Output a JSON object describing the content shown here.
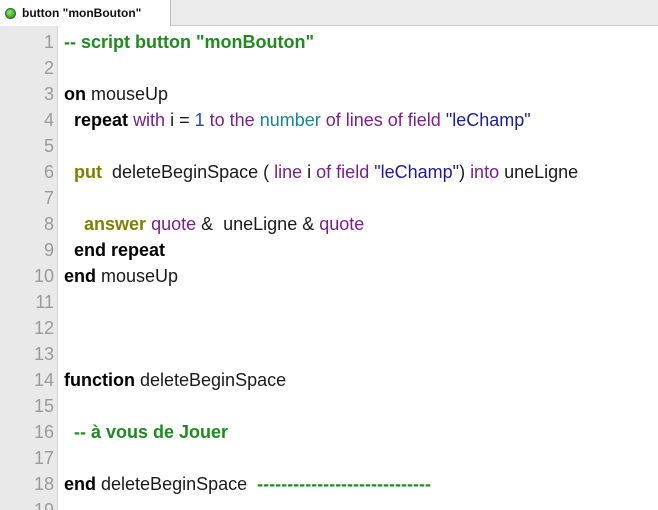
{
  "tab": {
    "title": "button \"monBouton\"",
    "status_color": "#46b32e"
  },
  "colors": {
    "keyword": "#000000",
    "command": "#808000",
    "purple": "#7b1f8a",
    "teal": "#138a8a",
    "number": "#1f3fcf",
    "string": "#1c1c9c",
    "comment": "#1e8b1e",
    "line_number": "#9a9a9a"
  },
  "code": {
    "lines": [
      {
        "number": "1",
        "tokens": [
          {
            "t": "-- script button \"monBouton\"",
            "k": "comment"
          }
        ]
      },
      {
        "number": "2",
        "tokens": []
      },
      {
        "number": "3",
        "tokens": [
          {
            "t": "on",
            "k": "kw"
          },
          {
            "t": " mouseUp",
            "k": "plain"
          }
        ]
      },
      {
        "number": "4",
        "tokens": [
          {
            "t": "  ",
            "k": "plain"
          },
          {
            "t": "repeat",
            "k": "kw"
          },
          {
            "t": " ",
            "k": "plain"
          },
          {
            "t": "with",
            "k": "purple"
          },
          {
            "t": " i = ",
            "k": "plain"
          },
          {
            "t": "1",
            "k": "num"
          },
          {
            "t": " ",
            "k": "plain"
          },
          {
            "t": "to the",
            "k": "purple"
          },
          {
            "t": " ",
            "k": "plain"
          },
          {
            "t": "number",
            "k": "teal"
          },
          {
            "t": " ",
            "k": "plain"
          },
          {
            "t": "of lines of field",
            "k": "purple"
          },
          {
            "t": " ",
            "k": "plain"
          },
          {
            "t": "\"leChamp\"",
            "k": "str"
          }
        ]
      },
      {
        "number": "5",
        "tokens": []
      },
      {
        "number": "6",
        "tokens": [
          {
            "t": "  ",
            "k": "plain"
          },
          {
            "t": "put",
            "k": "cmd"
          },
          {
            "t": "  deleteBeginSpace ( ",
            "k": "plain"
          },
          {
            "t": "line",
            "k": "purple"
          },
          {
            "t": " i ",
            "k": "plain"
          },
          {
            "t": "of field",
            "k": "purple"
          },
          {
            "t": " ",
            "k": "plain"
          },
          {
            "t": "\"leChamp\"",
            "k": "str"
          },
          {
            "t": ") ",
            "k": "plain"
          },
          {
            "t": "into",
            "k": "purple"
          },
          {
            "t": " uneLigne",
            "k": "plain"
          }
        ]
      },
      {
        "number": "7",
        "tokens": []
      },
      {
        "number": "8",
        "tokens": [
          {
            "t": "    ",
            "k": "plain"
          },
          {
            "t": "answer",
            "k": "cmd"
          },
          {
            "t": " ",
            "k": "plain"
          },
          {
            "t": "quote",
            "k": "purple"
          },
          {
            "t": " &  uneLigne & ",
            "k": "plain"
          },
          {
            "t": "quote",
            "k": "purple"
          }
        ]
      },
      {
        "number": "9",
        "tokens": [
          {
            "t": "  ",
            "k": "plain"
          },
          {
            "t": "end repeat",
            "k": "kw"
          }
        ]
      },
      {
        "number": "10",
        "tokens": [
          {
            "t": "end",
            "k": "kw"
          },
          {
            "t": " mouseUp",
            "k": "plain"
          }
        ]
      },
      {
        "number": "11",
        "tokens": []
      },
      {
        "number": "12",
        "tokens": []
      },
      {
        "number": "13",
        "tokens": []
      },
      {
        "number": "14",
        "tokens": [
          {
            "t": "function",
            "k": "kw"
          },
          {
            "t": " deleteBeginSpace",
            "k": "plain"
          }
        ]
      },
      {
        "number": "15",
        "tokens": []
      },
      {
        "number": "16",
        "tokens": [
          {
            "t": "  ",
            "k": "plain"
          },
          {
            "t": "-- à vous de Jouer",
            "k": "comment"
          }
        ]
      },
      {
        "number": "17",
        "tokens": []
      },
      {
        "number": "18",
        "tokens": [
          {
            "t": "end",
            "k": "kw"
          },
          {
            "t": " deleteBeginSpace  ",
            "k": "plain"
          },
          {
            "t": "-----------------------------",
            "k": "comment"
          }
        ]
      },
      {
        "number": "19",
        "tokens": []
      }
    ]
  }
}
